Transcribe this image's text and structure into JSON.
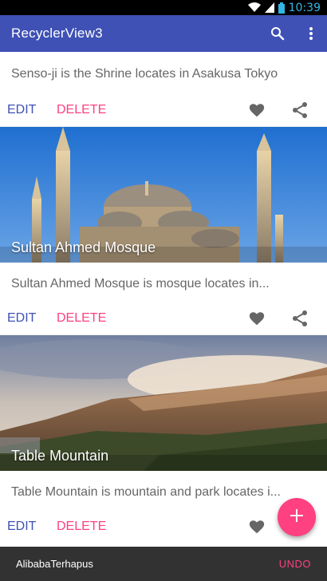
{
  "status_bar": {
    "time": "10:39",
    "icons": [
      "wifi-icon",
      "signal-icon",
      "battery-icon"
    ]
  },
  "app_bar": {
    "title": "RecyclerView3",
    "icons": [
      "search-icon",
      "overflow-menu-icon"
    ],
    "color": "#3f51b5"
  },
  "cards": [
    {
      "description": "Senso-ji is the Shrine locates in Asakusa Tokyo",
      "edit_label": "EDIT",
      "delete_label": "DELETE"
    },
    {
      "image_title": "Sultan Ahmed Mosque",
      "description": "Sultan Ahmed Mosque is mosque locates in...",
      "edit_label": "EDIT",
      "delete_label": "DELETE"
    },
    {
      "image_title": "Table Mountain",
      "description": "Table Mountain is mountain and park locates i...",
      "edit_label": "EDIT",
      "delete_label": "DELETE"
    }
  ],
  "snackbar": {
    "message": "AlibabaTerhapus",
    "action": "UNDO"
  },
  "colors": {
    "primary": "#3f51b5",
    "accent": "#ff4081",
    "edit_text": "#3f51b5",
    "delete_text": "#ff4081"
  }
}
